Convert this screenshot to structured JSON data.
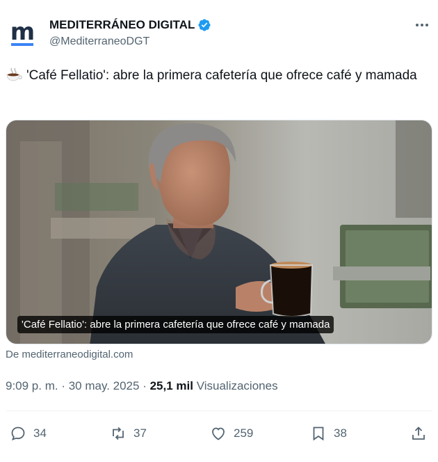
{
  "account": {
    "name": "MEDITERRÁNEO DIGITAL",
    "handle": "@MediterraneoDGT",
    "avatar_letter": "m",
    "verified_color": "#1d9bf0",
    "brand_color": "#1f2f46",
    "brand_accent": "#3b83f6"
  },
  "tweet": {
    "emoji": "hot-beverage-icon",
    "text": "'Café Fellatio': abre la primera cafetería que ofrece café y mamada"
  },
  "card": {
    "caption": "'Café Fellatio': abre la primera cafetería que ofrece café y mamada",
    "source": "De mediterraneodigital.com"
  },
  "meta": {
    "time": "9:09 p. m.",
    "sep1": " · ",
    "date": "30 may. 2025",
    "sep2": " · ",
    "views_count": "25,1 mil",
    "views_label": "Visualizaciones"
  },
  "actions": {
    "replies": "34",
    "reposts": "37",
    "likes": "259",
    "bookmarks": "38"
  }
}
